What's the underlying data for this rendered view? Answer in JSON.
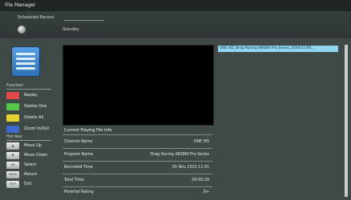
{
  "window": {
    "title": "File Manager"
  },
  "scheduled": {
    "label": "Scheduled Record",
    "status": "Standby"
  },
  "function_panel": {
    "title": "Function",
    "items": [
      {
        "label": "Replay",
        "color": "#e34b4b"
      },
      {
        "label": "Delete One",
        "color": "#58c447"
      },
      {
        "label": "Delete All",
        "color": "#e6d133"
      },
      {
        "label": "Zoom In/Out",
        "color": "#3f6bd0"
      }
    ]
  },
  "hot_key_panel": {
    "title": "Hot Key",
    "items": [
      {
        "key": "▲",
        "label": "Move Up"
      },
      {
        "key": "▼",
        "label": "Move Down"
      },
      {
        "key": "OK",
        "label": "Select"
      },
      {
        "key": "MENU",
        "label": "Return"
      },
      {
        "key": "EXIT",
        "label": "Exit"
      }
    ]
  },
  "info": {
    "heading": "Current Playing File Info",
    "rows": [
      {
        "key": "Channel Name",
        "value": "ONE HD"
      },
      {
        "key": "Program Name",
        "value": "Drag Racing ANDRA Pro Series"
      },
      {
        "key": "Recorded Time",
        "value": "05 Nov 2010 12:41"
      },
      {
        "key": "Total Time",
        "value": "00:00:28"
      },
      {
        "key": "Parental Rating",
        "value": "8+"
      }
    ]
  },
  "file_list": {
    "items": [
      {
        "label": "ONE HD_Drag Racing ANDRA Pro Series_2010/11/05..."
      }
    ]
  }
}
